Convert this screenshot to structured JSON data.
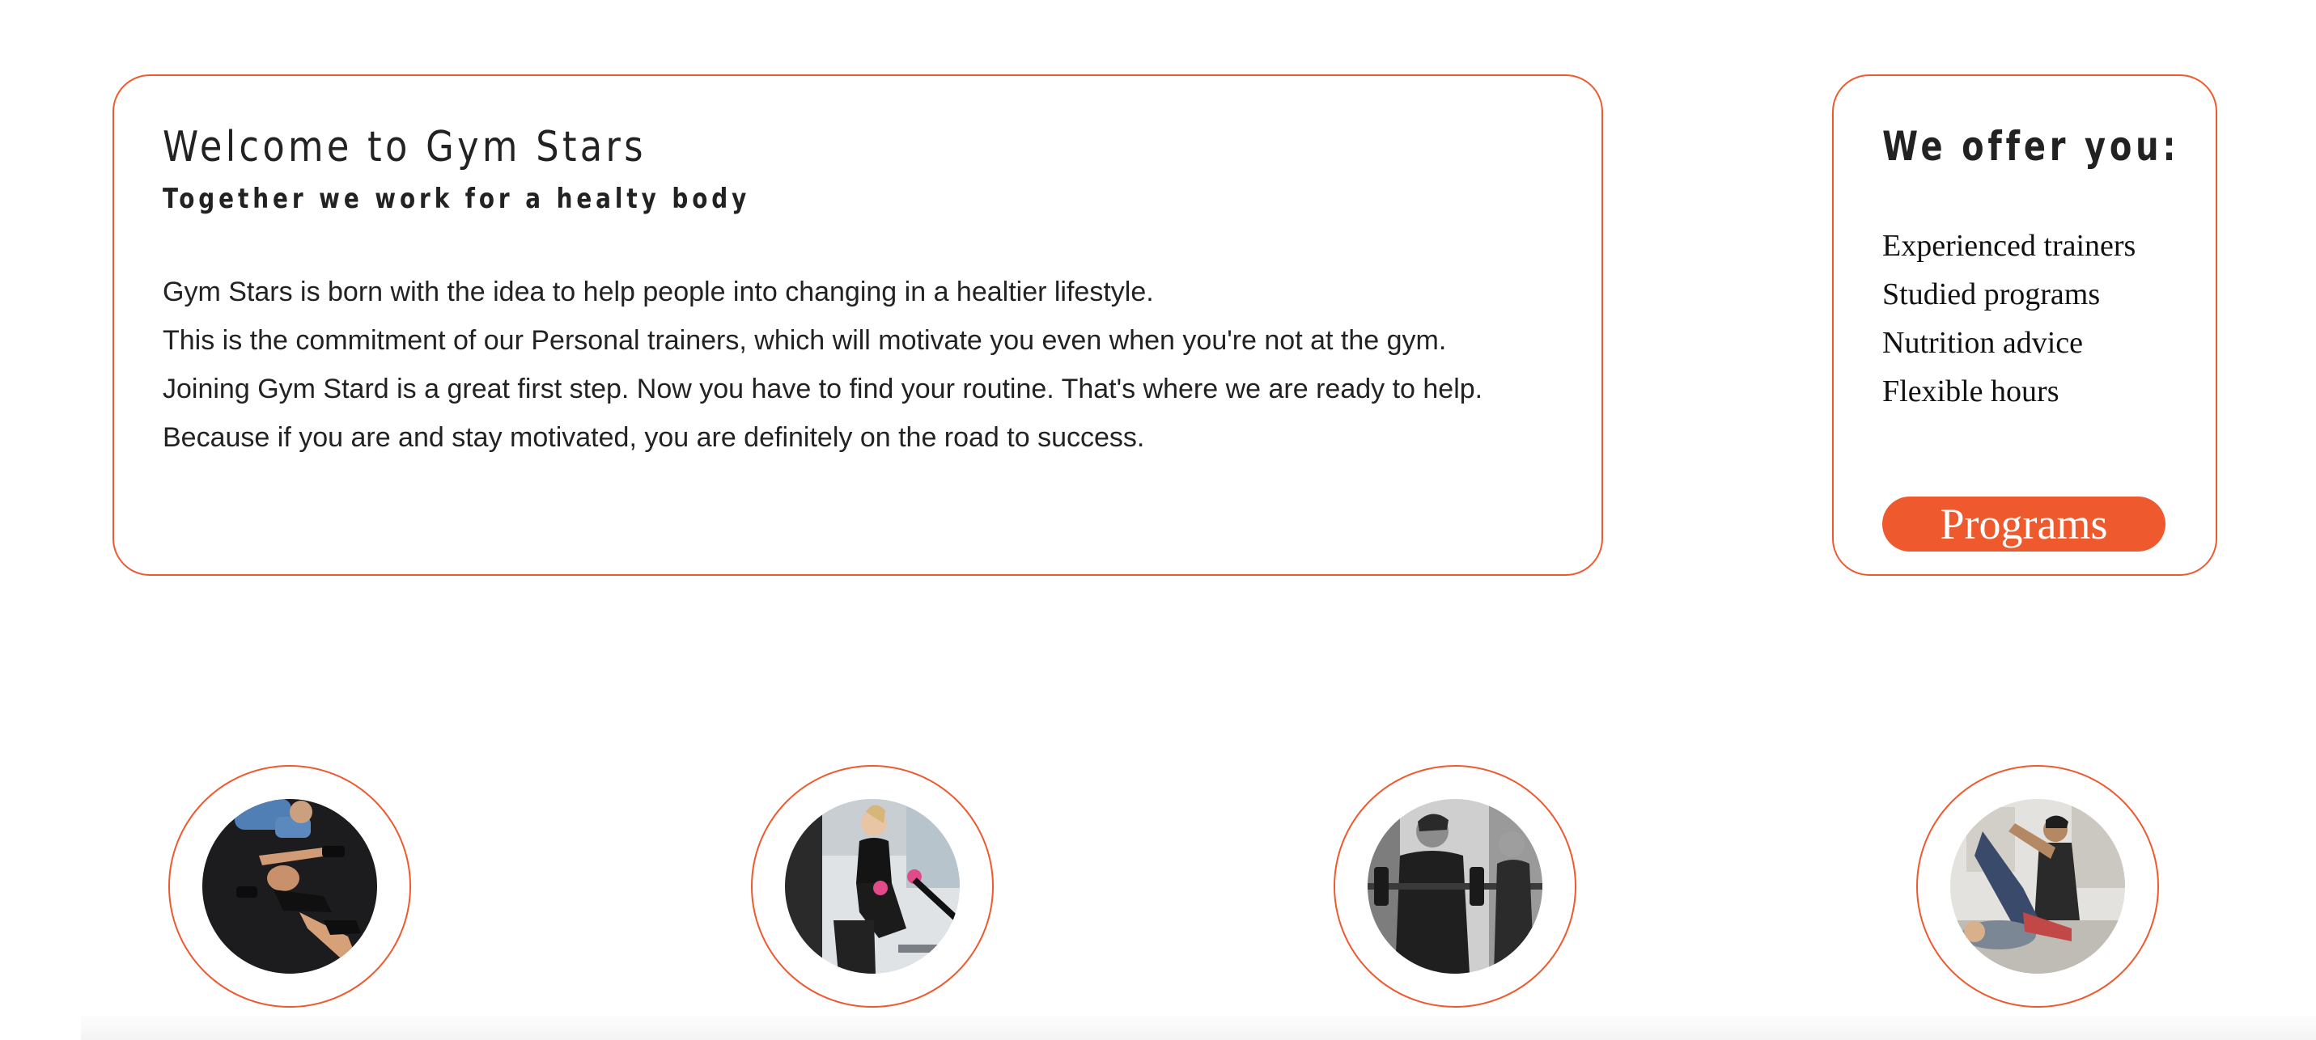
{
  "welcome": {
    "title": "Welcome to Gym Stars",
    "subtitle": "Together we work for a healty body",
    "paragraphs": [
      "Gym Stars is born with the idea to help people into changing in a healtier lifestyle.",
      "This is the commitment of our Personal trainers, which will motivate you even when you're not at the gym.",
      "Joining Gym Stard is a great first step. Now you have to find your routine. That's where we are ready to help.",
      "Because if you are and stay motivated, you are definitely on the road to success."
    ]
  },
  "offer": {
    "title": "We offer you:",
    "items": [
      "Experienced trainers",
      "Studied programs",
      "Nutrition advice",
      "Flexible hours"
    ],
    "button_label": "Programs"
  },
  "colors": {
    "accent": "#ee5a2e",
    "text": "#222222",
    "background": "#ffffff"
  },
  "photos": [
    {
      "icon": "trainer-spotting-dumbbell-photo"
    },
    {
      "icon": "woman-rowing-machine-photo"
    },
    {
      "icon": "man-barbell-curl-photo"
    },
    {
      "icon": "assisted-floor-exercise-photo"
    }
  ]
}
